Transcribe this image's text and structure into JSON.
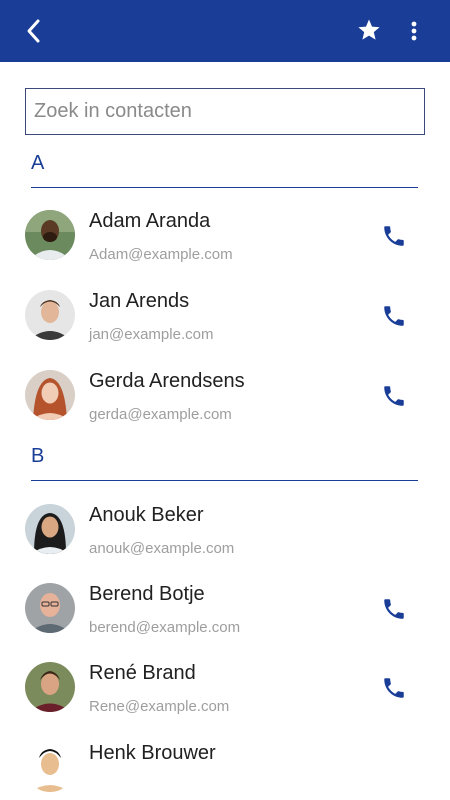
{
  "toolbar": {
    "back_icon": "back-arrow-icon",
    "favorite_icon": "star-icon",
    "menu_icon": "more-vertical-icon",
    "background_color": "#1a3e97"
  },
  "search": {
    "placeholder": "Zoek in contacten",
    "value": ""
  },
  "sections": [
    {
      "letter": "A",
      "contacts": [
        {
          "name": "Adam Aranda",
          "email": "Adam@example.com",
          "has_phone": true
        },
        {
          "name": "Jan Arends",
          "email": "jan@example.com",
          "has_phone": true
        },
        {
          "name": "Gerda Arendsens",
          "email": "gerda@example.com",
          "has_phone": true
        }
      ]
    },
    {
      "letter": "B",
      "contacts": [
        {
          "name": "Anouk Beker",
          "email": "anouk@example.com",
          "has_phone": false
        },
        {
          "name": "Berend Botje",
          "email": "berend@example.com",
          "has_phone": true
        },
        {
          "name": "René Brand",
          "email": "Rene@example.com",
          "has_phone": true
        },
        {
          "name": "Henk Brouwer",
          "email": "",
          "has_phone": false
        }
      ]
    }
  ],
  "colors": {
    "accent": "#1a3e97",
    "secondary_text": "#9e9e9e"
  }
}
